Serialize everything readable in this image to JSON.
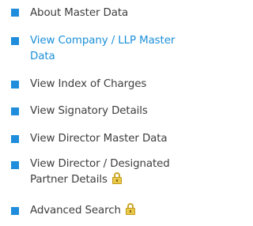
{
  "menu": {
    "items": [
      {
        "label": "About Master Data",
        "active": false,
        "locked": false
      },
      {
        "label": "View Company / LLP Master Data",
        "active": true,
        "locked": false
      },
      {
        "label": "View Index of Charges",
        "active": false,
        "locked": false
      },
      {
        "label": "View Signatory Details",
        "active": false,
        "locked": false
      },
      {
        "label": "View Director Master Data",
        "active": false,
        "locked": false
      },
      {
        "label": "View Director / Designated Partner Details",
        "active": false,
        "locked": true
      },
      {
        "label": "Advanced Search",
        "active": false,
        "locked": true
      }
    ],
    "bullet_color": "#1f8ddb",
    "active_text_color": "#1a8fd9",
    "text_color": "#3d3d3d",
    "lock_icon": "lock-icon"
  }
}
